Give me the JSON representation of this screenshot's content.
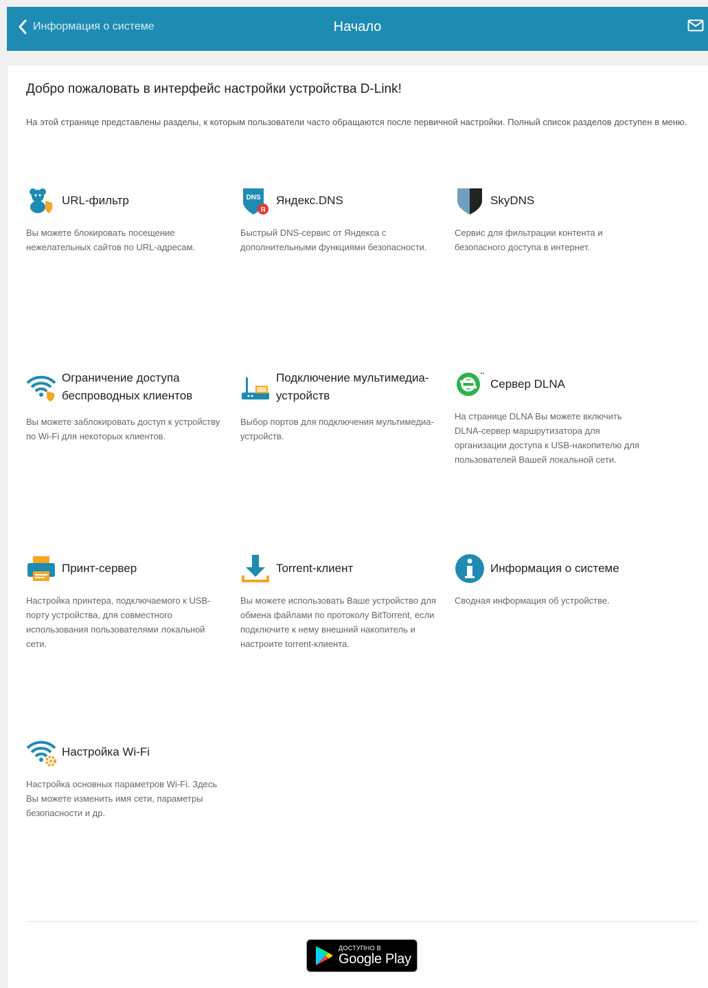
{
  "header": {
    "back_label": "Информация о системе",
    "title": "Начало"
  },
  "welcome": {
    "heading": "Добро пожаловать в интерфейс настройки устройства D-Link!",
    "intro": "На этой странице представлены разделы, к которым пользователи часто обращаются после первичной настройки. Полный список разделов доступен в меню."
  },
  "cards": [
    {
      "title": "URL-фильтр",
      "desc": "Вы можете блокировать посещение нежелательных сайтов по URL-адресам.",
      "icon": "bear-shield-icon"
    },
    {
      "title": "Яндекс.DNS",
      "desc": "Быстрый DNS-сервис от Яндекса с дополнительными функциями безопасности.",
      "icon": "yandex-dns-icon"
    },
    {
      "title": "SkyDNS",
      "desc": "Сервис для фильтрации контента и безопасного доступа в интернет.",
      "icon": "shield-icon"
    },
    {
      "title": "Ограничение доступа беспроводных клиентов",
      "desc": "Вы можете заблокировать доступ к устройству по Wi-Fi для некоторых клиентов.",
      "icon": "wifi-shield-icon"
    },
    {
      "title": "Подключение мультимедиа-устройств",
      "desc": "Выбор портов для подключения мультимедиа-устройств.",
      "icon": "router-tv-icon"
    },
    {
      "title": "Сервер DLNA",
      "desc": "На странице DLNA Вы можете включить DLNA-сервер маршрутизатора для организации доступа к USB-накопителю для пользователей Вашей локальной сети.",
      "icon": "dlna-icon"
    },
    {
      "title": "Принт-сервер",
      "desc": "Настройка принтера, подключаемого к USB-порту устройства, для совместного использования пользователями локальной сети.",
      "icon": "printer-icon"
    },
    {
      "title": "Torrent-клиент",
      "desc": "Вы можете использовать Ваше устройство для обмена файлами по протоколу BitTorrent, если подключите к нему внешний накопитель и настроите torrent-клиента.",
      "icon": "download-icon"
    },
    {
      "title": "Информация о системе",
      "desc": "Сводная информация об устройстве.",
      "icon": "info-icon"
    },
    {
      "title": "Настройка Wi-Fi",
      "desc": "Настройка основных параметров Wi-Fi. Здесь Вы можете изменить имя сети, параметры безопасности и др.",
      "icon": "wifi-gear-icon"
    }
  ],
  "badge": {
    "small": "ДОСТУПНО В",
    "big": "Google Play"
  },
  "colors": {
    "header_bg": "#1e8bb3",
    "icon_blue": "#1e8bb3",
    "accent_orange": "#f5a623",
    "dlna_green": "#2db34a"
  }
}
